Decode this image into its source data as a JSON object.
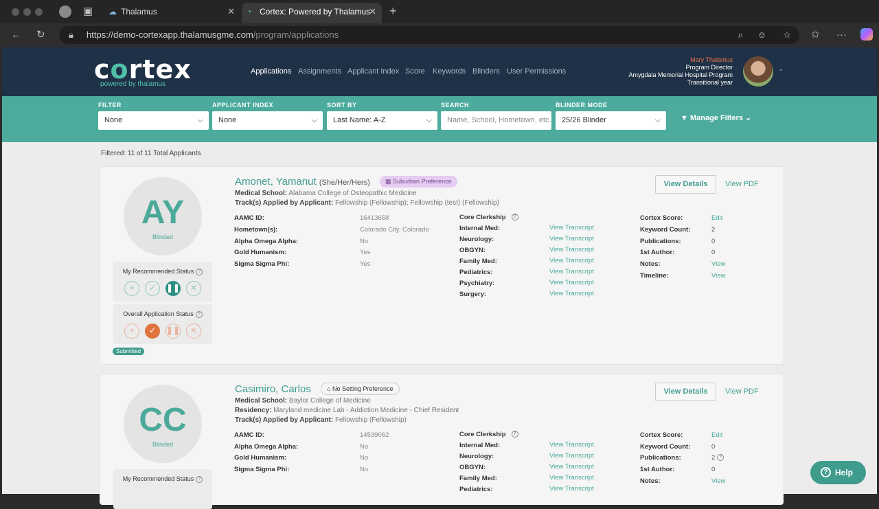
{
  "browser": {
    "tabs": [
      {
        "label": "Thalamus"
      },
      {
        "label": "Cortex: Powered by Thalamus"
      }
    ],
    "url_base": "https://demo-cortexapp.thalamusgme.com",
    "url_path": "/program/applications"
  },
  "header": {
    "logo": "cortex",
    "tagline": "powered by thalamus",
    "nav": [
      "Applications",
      "Assignments",
      "Applicant Index",
      "Score",
      "Keywords",
      "Blinders",
      "User Permissions"
    ],
    "user": {
      "name": "Mary Thalamus",
      "role": "Program Director",
      "program": "Amygdala Memorial Hospital Program",
      "year": "Transitional year"
    }
  },
  "filters": {
    "filter_label": "FILTER",
    "filter_value": "None",
    "index_label": "APPLICANT INDEX",
    "index_value": "None",
    "sort_label": "SORT BY",
    "sort_value": "Last Name: A-Z",
    "search_label": "SEARCH",
    "search_placeholder": "Name, School, Hometown, etc.",
    "blinder_label": "BLINDER MODE",
    "blinder_value": "25/26 Blinder",
    "manage_label": "Manage Filters"
  },
  "summary": "Filtered: 11 of 11 Total Applicants",
  "common": {
    "blinded": "Blinded",
    "my_status": "My Recommended Status",
    "overall_status": "Overall Application Status",
    "view_details": "View Details",
    "view_pdf": "View PDF",
    "view_transcript": "View Transcript",
    "core_clerkship": "Core Clerkship",
    "aamc_label": "AAMC ID:",
    "hometown_label": "Hometown(s):",
    "aoa_label": "Alpha Omega Alpha:",
    "gold_label": "Gold Humanism:",
    "sigma_label": "Sigma Sigma Phi:",
    "cortex_score_label": "Cortex Score:",
    "keyword_label": "Keyword Count:",
    "pubs_label": "Publications:",
    "first_author_label": "1st Author:",
    "notes_label": "Notes:",
    "timeline_label": "Timeline:",
    "edit": "Edit",
    "view": "View",
    "medschool_label": "Medical School:",
    "residency_label": "Residency:",
    "tracks_label": "Track(s) Applied by Applicant:",
    "help": "Help"
  },
  "applicants": [
    {
      "name": "Amonet, Yamanut",
      "pronouns": "(She/Her/Hers)",
      "initials": "AY",
      "preference": "Suburban Preference",
      "medical_school": "Alabama College of Osteopathic Medicine",
      "tracks": "Fellowship (Fellowship); Fellowship (test) (Fellowship)",
      "aamc_id": "16413658",
      "hometown": "Colorado City, Colorado",
      "aoa": "No",
      "gold": "Yes",
      "sigma": "Yes",
      "clerkships": [
        "Internal Med:",
        "Neurology:",
        "OBGYN:",
        "Family Med:",
        "Pediatrics:",
        "Psychiatry:",
        "Surgery:"
      ],
      "keyword_count": "2",
      "publications": "0",
      "first_author": "0",
      "overall_badge": "Submitted"
    },
    {
      "name": "Casimiro, Carlos",
      "initials": "CC",
      "preference": "No Setting Preference",
      "medical_school": "Baylor College of Medicine",
      "residency": "Maryland medicine Lab - Addiction Medicine - Chief Resident",
      "tracks": "Fellowship (Fellowship)",
      "aamc_id": "14539062",
      "aoa": "No",
      "gold": "No",
      "sigma": "No",
      "clerkships": [
        "Internal Med:",
        "Neurology:",
        "OBGYN:",
        "Family Med:",
        "Pediatrics:"
      ],
      "keyword_count": "0",
      "publications": "2",
      "first_author": "0"
    }
  ]
}
